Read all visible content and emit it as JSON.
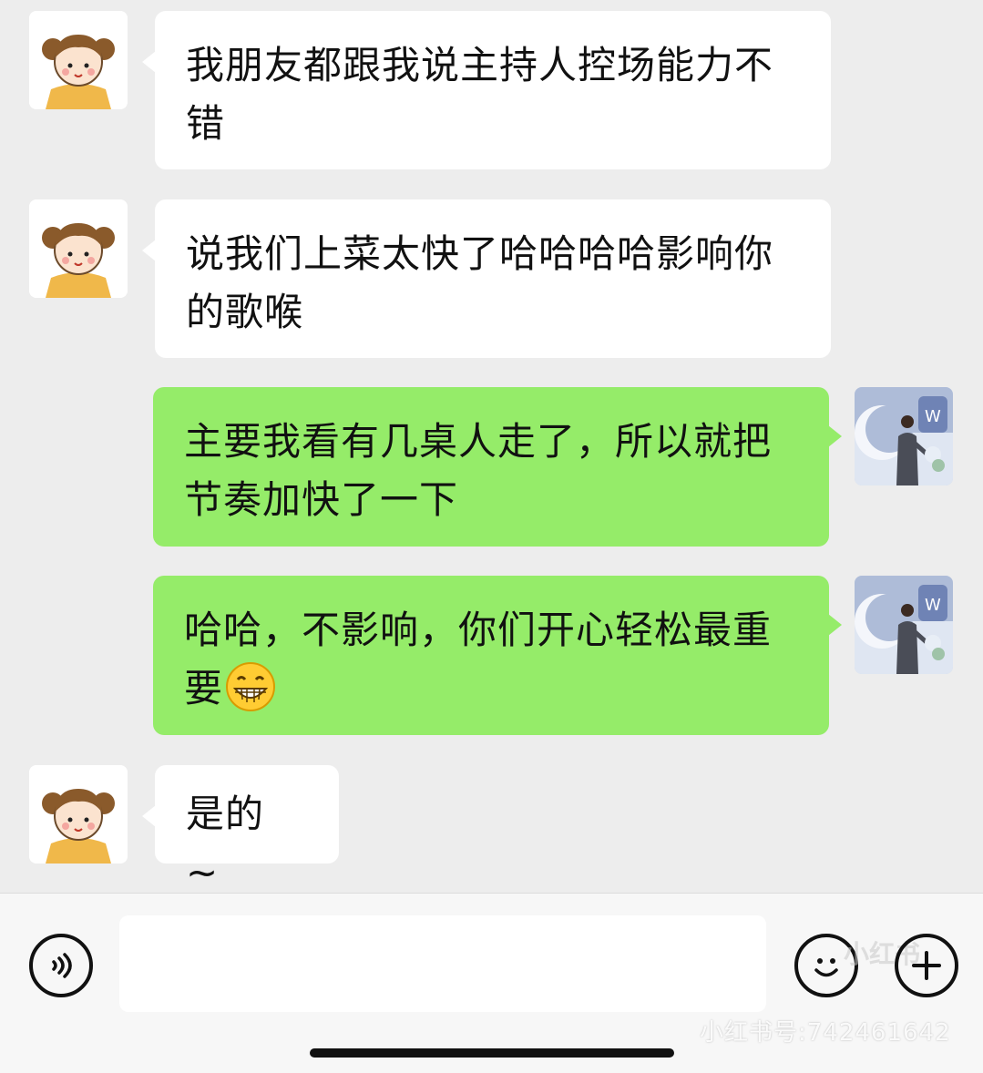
{
  "messages": [
    {
      "side": "in",
      "avatar": "cartoon-girl-avatar",
      "text": "我朋友都跟我说主持人控场能力不错"
    },
    {
      "side": "in",
      "avatar": "cartoon-girl-avatar",
      "text": "说我们上菜太快了哈哈哈哈影响你的歌喉"
    },
    {
      "side": "out",
      "avatar": "host-photo-avatar",
      "text": "主要我看有几桌人走了，所以就把节奏加快了一下"
    },
    {
      "side": "out",
      "avatar": "host-photo-avatar",
      "text": "哈哈，不影响，你们开心轻松最重要",
      "emoji": "grinning-face-emoji"
    },
    {
      "side": "in",
      "avatar": "cartoon-girl-avatar",
      "text": "是的 ~"
    }
  ],
  "input_bar": {
    "voice_icon": "voice-icon",
    "emoji_icon": "emoji-icon",
    "plus_icon": "plus-icon",
    "input_value": ""
  },
  "watermark": {
    "text": "小红书号:742461642",
    "small_text": "小红书"
  },
  "colors": {
    "background": "#ededed",
    "incoming_bubble": "#ffffff",
    "outgoing_bubble": "#95ec69"
  }
}
